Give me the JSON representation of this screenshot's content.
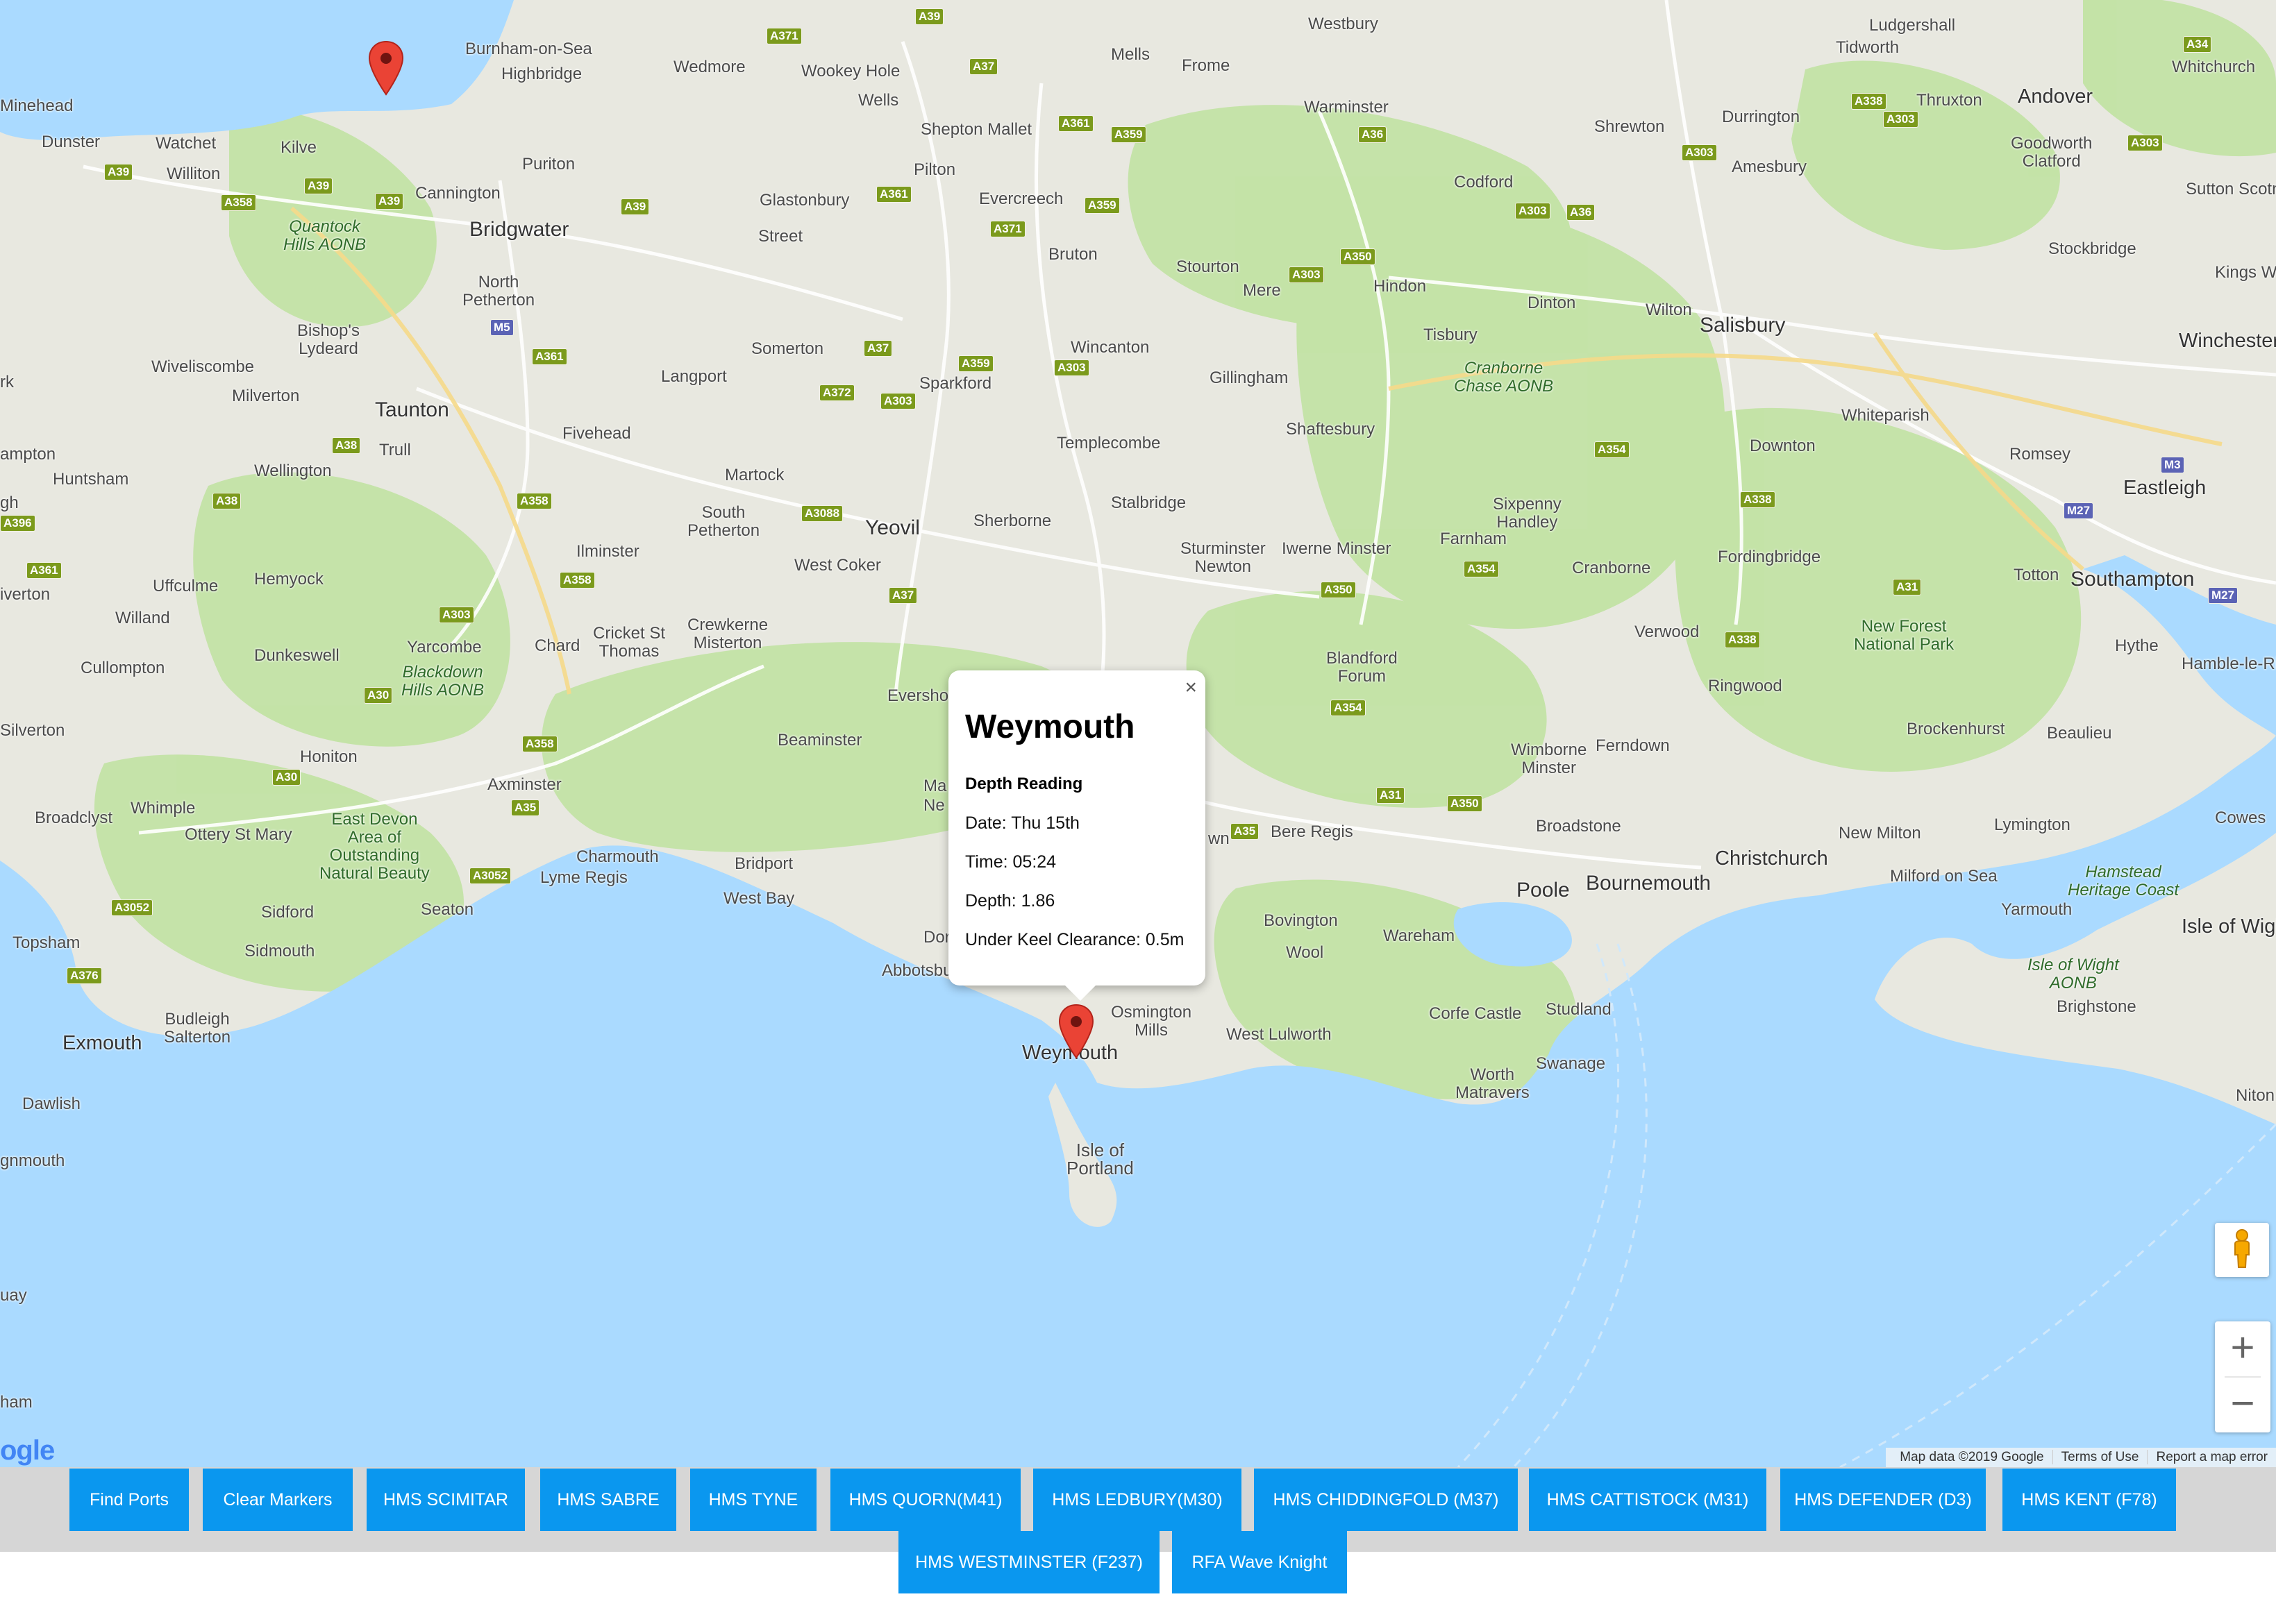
{
  "map": {
    "labels": {
      "minehead": "Minehead",
      "dunster": "Dunster",
      "watchet": "Watchet",
      "williton": "Williton",
      "kilve": "Kilve",
      "burnham": "Burnham-on-Sea",
      "highbridge": "Highbridge",
      "wedmore": "Wedmore",
      "wookey": "Wookey Hole",
      "wells": "Wells",
      "mells": "Mells",
      "frome": "Frome",
      "westbury": "Westbury",
      "warminster": "Warminster",
      "ludgershall": "Ludgershall",
      "tidworth": "Tidworth",
      "andover": "Andover",
      "thruxton": "Thruxton",
      "whitchurch": "Whitchurch",
      "durrington": "Durrington",
      "shrewton": "Shrewton",
      "amesbury": "Amesbury",
      "goodworth": "Goodworth\nClatford",
      "sutton_scotney": "Sutton Scotney",
      "kings_worthy": "Kings Worth",
      "winchester": "Winchester",
      "stockbridge": "Stockbridge",
      "salisbury": "Salisbury",
      "wilton": "Wilton",
      "codford": "Codford",
      "hindon": "Hindon",
      "dinton": "Dinton",
      "tisbury": "Tisbury",
      "cranborne_aonb": "Cranborne\nChase AONB",
      "whiteparish": "Whiteparish",
      "romsey": "Romsey",
      "eastleigh": "Eastleigh",
      "downton": "Downton",
      "southampton": "Southampton",
      "totton": "Totton",
      "hythe": "Hythe",
      "hamble": "Hamble-le-Rice",
      "new_forest": "New Forest\nNational Park",
      "fordingbridge": "Fordingbridge",
      "verwood": "Verwood",
      "ringwood": "Ringwood",
      "brockenhurst": "Brockenhurst",
      "beaulieu": "Beaulieu",
      "lymington": "Lymington",
      "new_milton": "New Milton",
      "milford": "Milford on Sea",
      "christchurch": "Christchurch",
      "bournemouth": "Bournemouth",
      "poole": "Poole",
      "ferndown": "Ferndown",
      "wimborne": "Wimborne\nMinster",
      "broadstone": "Broadstone",
      "cowes": "Cowes",
      "hamstead": "Hamstead\nHeritage Coast",
      "yarmouth": "Yarmouth",
      "isle_wight": "Isle of Wigh",
      "iow_aonb": "Isle of Wight\nAONB",
      "brighstone": "Brighstone",
      "niton": "Niton",
      "sixpenny": "Sixpenny\nHandley",
      "farnham": "Farnham",
      "cranborne": "Cranborne",
      "blandford": "Blandford\nForum",
      "iwerne": "Iwerne Minster",
      "sturminster": "Sturminster\nNewton",
      "shaftesbury": "Shaftesbury",
      "gillingham": "Gillingham",
      "stourton": "Stourton",
      "mere": "Mere",
      "wincanton": "Wincanton",
      "templecombe": "Templecombe",
      "stalbridge": "Stalbridge",
      "sherborne": "Sherborne",
      "yeovil": "Yeovil",
      "west_coker": "West Coker",
      "sparkford": "Sparkford",
      "bruton": "Bruton",
      "evercreech": "Evercreech",
      "shepton": "Shepton Mallet",
      "pilton": "Pilton",
      "glastonbury": "Glastonbury",
      "street": "Street",
      "somerton": "Somerton",
      "langport": "Langport",
      "martock": "Martock",
      "south_petherton": "South\nPetherton",
      "ilminster": "Ilminster",
      "crewkerne": "Crewkerne\nMisterton",
      "cricket": "Cricket St\nThomas",
      "chard": "Chard",
      "fivehead": "Fivehead",
      "puriton": "Puriton",
      "cannington": "Cannington",
      "bridgwater": "Bridgwater",
      "north_petherton": "North\nPetherton",
      "quantock": "Quantock\nHills AONB",
      "bishops": "Bishop's\nLydeard",
      "wiveliscombe": "Wiveliscombe",
      "milverton": "Milverton",
      "taunton": "Taunton",
      "trull": "Trull",
      "wellington": "Wellington",
      "ampton": "ampton",
      "huntsham": "Huntsham",
      "tiverton": "iverton",
      "uffculme": "Uffculme",
      "hemyock": "Hemyock",
      "willand": "Willand",
      "cullompton": "Cullompton",
      "dunkeswell": "Dunkeswell",
      "yarcombe": "Yarcombe",
      "blackdown": "Blackdown\nHills AONB",
      "silverton": "Silverton",
      "honiton": "Honiton",
      "broadclyst": "Broadclyst",
      "whimple": "Whimple",
      "ottery": "Ottery St Mary",
      "east_devon": "East Devon\nArea of\nOutstanding\nNatural Beauty",
      "sidford": "Sidford",
      "sidmouth": "Sidmouth",
      "seaton": "Seaton",
      "axminster": "Axminster",
      "charmouth": "Charmouth",
      "lyme": "Lyme Regis",
      "bridport": "Bridport",
      "west_bay": "West Bay",
      "beaminster": "Beaminster",
      "evershot": "Evershot",
      "topsham": "Topsham",
      "budleigh": "Budleigh\nSalterton",
      "exmouth": "Exmouth",
      "dawlish": "Dawlish",
      "teignmouth": "gnmouth",
      "torquay": "uay",
      "newton": "ham",
      "abbotsbury": "Abbotsbury",
      "weymouth": "Weymouth",
      "osmington": "Osmington\nMills",
      "portland": "Isle of\nPortland",
      "west_lulworth": "West Lulworth",
      "corfe": "Corfe Castle",
      "studland": "Studland",
      "swanage": "Swanage",
      "worth": "Worth\nMatravers",
      "wareham": "Wareham",
      "wool": "Wool",
      "bovington": "Bovington",
      "bere": "Bere Regis",
      "dorchester_frag": "Dor",
      "maiden_frag": "Ma",
      "piddle_frag": "wn",
      "mid_frag": "Ne",
      "rk": "rk",
      "gh": "gh"
    },
    "roads": {
      "a39_a": "A39",
      "a371": "A371",
      "a37": "A37",
      "a361": "A361",
      "a359": "A359",
      "a39_b": "A39",
      "a358": "A358",
      "a39_c": "A39",
      "a39_d": "A39",
      "a371_b": "A371",
      "a361_b": "A361",
      "a359_b": "A359",
      "m5": "M5",
      "a361_c": "A361",
      "a37_b": "A37",
      "a359_c": "A359",
      "a303_a": "A303",
      "a372": "A372",
      "a303_b": "A303",
      "a38_a": "A38",
      "a358_b": "A358",
      "a38_b": "A38",
      "a3088": "A3088",
      "a358_c": "A358",
      "a303_c": "A303",
      "a37_c": "A37",
      "a30": "A30",
      "a358_d": "A358",
      "a30_b": "A30",
      "a35": "A35",
      "a3052": "A3052",
      "a3052_b": "A3052",
      "a376": "A376",
      "a361_d": "A361",
      "a396": "A396",
      "a36": "A36",
      "a303_d": "A303",
      "a36_b": "A36",
      "a303_e": "A303",
      "a350": "A350",
      "a338": "A338",
      "a303_f": "A303",
      "a303_g": "A303",
      "a34": "A34",
      "a354": "A354",
      "a338_b": "A338",
      "a354_b": "A354",
      "a350_b": "A350",
      "a338_c": "A338",
      "a31": "A31",
      "a354_c": "A354",
      "a31_b": "A31",
      "a350_c": "A350",
      "a35_b": "A35",
      "m3": "M3",
      "m27": "M27",
      "m27_b": "M27"
    },
    "google_logo": "ogle",
    "attribution": {
      "map_data": "Map data ©2019 Google",
      "terms": "Terms of Use",
      "report": "Report a map error"
    }
  },
  "infowindow": {
    "title": "Weymouth",
    "subtitle": "Depth Reading",
    "date": "Date: Thu 15th",
    "time": "Time: 05:24",
    "depth": "Depth: 1.86",
    "ukc": "Under Keel Clearance: 0.5m",
    "close": "×"
  },
  "controls": {
    "zoom_in": "+",
    "zoom_out": "−"
  },
  "buttons": [
    "Find Ports",
    "Clear Markers",
    "HMS SCIMITAR",
    "HMS SABRE",
    "HMS TYNE",
    "HMS QUORN(M41)",
    "HMS LEDBURY(M30)",
    "HMS CHIDDINGFOLD (M37)",
    "HMS CATTISTOCK (M31)",
    "HMS DEFENDER (D3)",
    "HMS KENT (F78)",
    "HMS WESTMINSTER (F237)",
    "RFA Wave Knight"
  ],
  "colors": {
    "sea": "#aadaff",
    "land": "#e8e8e0",
    "green": "#c3e3a5",
    "button": "#0a97ef",
    "marker": "#ea4335"
  }
}
